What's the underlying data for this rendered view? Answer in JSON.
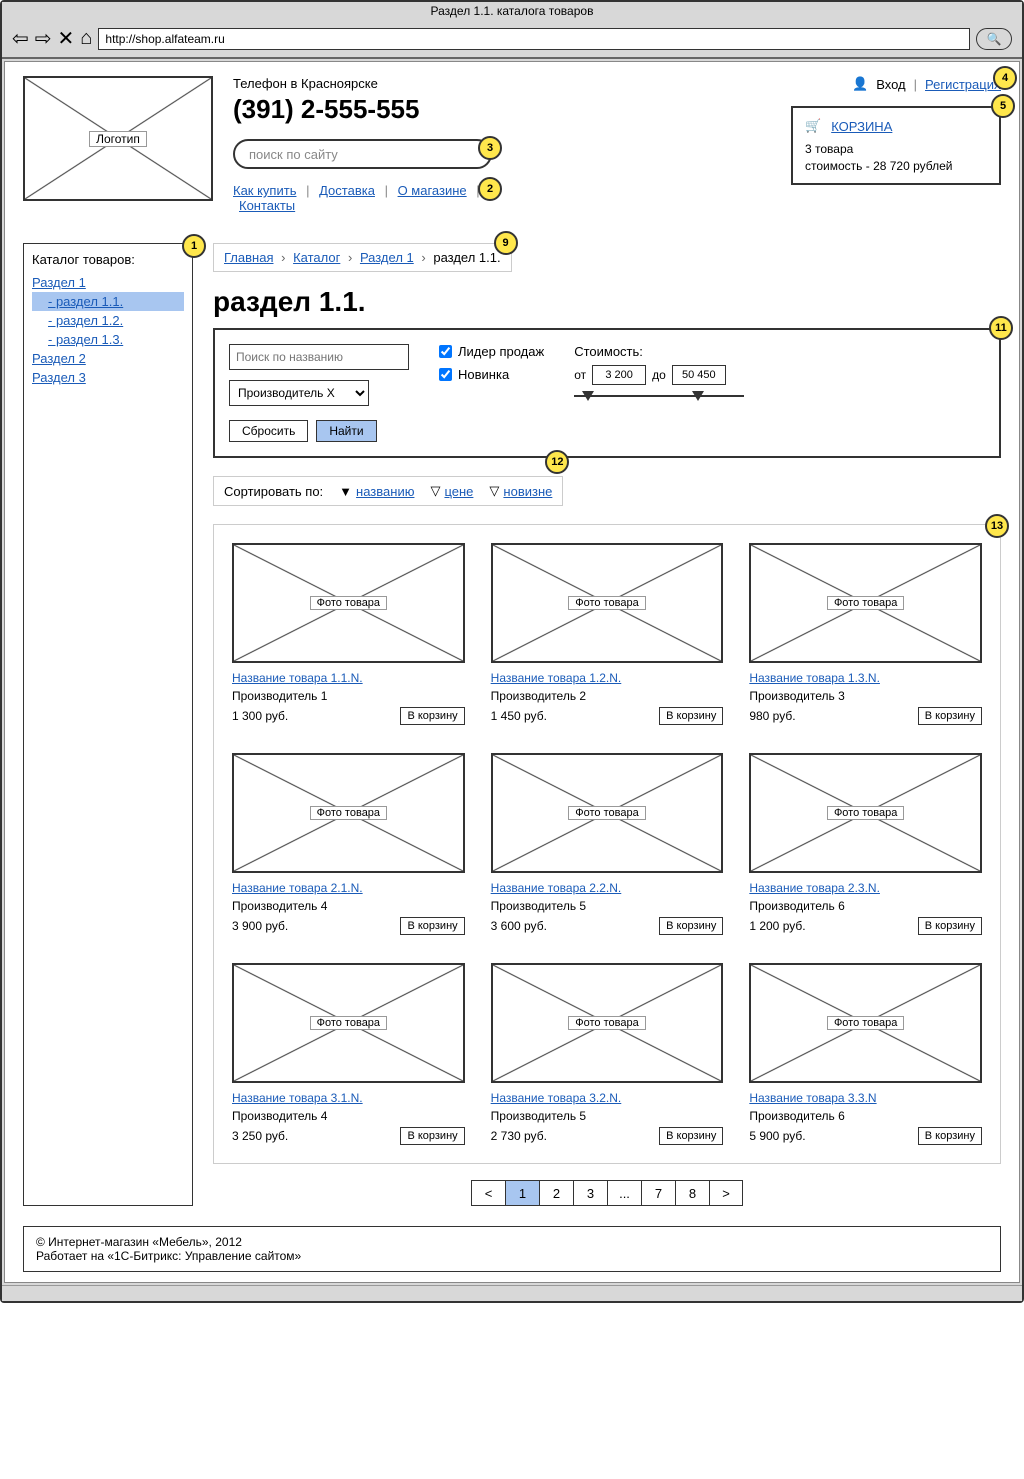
{
  "browser": {
    "title": "Раздел 1.1. каталога товаров",
    "url": "http://shop.alfateam.ru"
  },
  "header": {
    "logo_label": "Логотип",
    "phone_city": "Телефон в Красноярске",
    "phone_number": "(391) 2-555-555",
    "search_placeholder": "поиск по сайту",
    "nav_links": [
      "Как купить",
      "Доставка",
      "О магазине",
      "Контакты"
    ]
  },
  "auth": {
    "login": "Вход",
    "register": "Регистрация"
  },
  "cart": {
    "title": "КОРЗИНА",
    "items_line": "3 товара",
    "total_line": "стоимость - 28 720 рублей"
  },
  "sidebar": {
    "title": "Каталог товаров:",
    "items": [
      {
        "label": "Раздел 1",
        "level": 0,
        "active": false
      },
      {
        "label": "раздел 1.1.",
        "level": 1,
        "active": true,
        "prefix": "- "
      },
      {
        "label": "раздел 1.2.",
        "level": 1,
        "active": false,
        "prefix": "- "
      },
      {
        "label": "раздел 1.3.",
        "level": 1,
        "active": false,
        "prefix": "- "
      },
      {
        "label": "Раздел 2",
        "level": 0,
        "active": false
      },
      {
        "label": "Раздел 3",
        "level": 0,
        "active": false
      }
    ]
  },
  "breadcrumb": {
    "items": [
      "Главная",
      "Каталог",
      "Раздел 1"
    ],
    "current": "раздел 1.1."
  },
  "page_title": "раздел 1.1.",
  "filter": {
    "search_placeholder": "Поиск по названию",
    "brand_selected": "Производитель X",
    "reset_label": "Сбросить",
    "submit_label": "Найти",
    "cb_leader": "Лидер продаж",
    "cb_new": "Новинка",
    "cost_label": "Стоимость:",
    "cost_from_label": "от",
    "cost_to_label": "до",
    "cost_from": "3 200",
    "cost_to": "50 450"
  },
  "sort": {
    "label": "Сортировать по:",
    "by_name": "названию",
    "by_price": "цене",
    "by_new": "новизне"
  },
  "product_photo_label": "Фото товара",
  "products": [
    {
      "name": "Название товара 1.1.N.",
      "brand": "Производитель 1",
      "price": "1 300 руб."
    },
    {
      "name": "Название товара 1.2.N.",
      "brand": "Производитель 2",
      "price": "1 450 руб."
    },
    {
      "name": "Название товара 1.3.N.",
      "brand": "Производитель 3",
      "price": "980 руб."
    },
    {
      "name": "Название товара 2.1.N.",
      "brand": "Производитель 4",
      "price": "3 900 руб."
    },
    {
      "name": "Название товара 2.2.N.",
      "brand": "Производитель 5",
      "price": "3 600 руб."
    },
    {
      "name": "Название товара 2.3.N.",
      "brand": "Производитель 6",
      "price": "1 200 руб."
    },
    {
      "name": "Название товара 3.1.N.",
      "brand": "Производитель 4",
      "price": "3 250 руб."
    },
    {
      "name": "Название товара 3.2.N.",
      "brand": "Производитель 5",
      "price": "2 730 руб."
    },
    {
      "name": "Название товара 3.3.N",
      "brand": "Производитель 6",
      "price": "5 900 руб."
    }
  ],
  "add_to_cart_label": "В корзину",
  "pagination": [
    "<",
    "1",
    "2",
    "3",
    "...",
    "7",
    "8",
    ">"
  ],
  "pagination_active": "1",
  "footer": {
    "line1": "© Интернет-магазин «Мебель», 2012",
    "line2": "Работает на «1С-Битрикс: Управление сайтом»"
  },
  "annotations": {
    "a1": "1",
    "a2": "2",
    "a3": "3",
    "a4": "4",
    "a5": "5",
    "a9": "9",
    "a11": "11",
    "a12": "12",
    "a13": "13"
  }
}
